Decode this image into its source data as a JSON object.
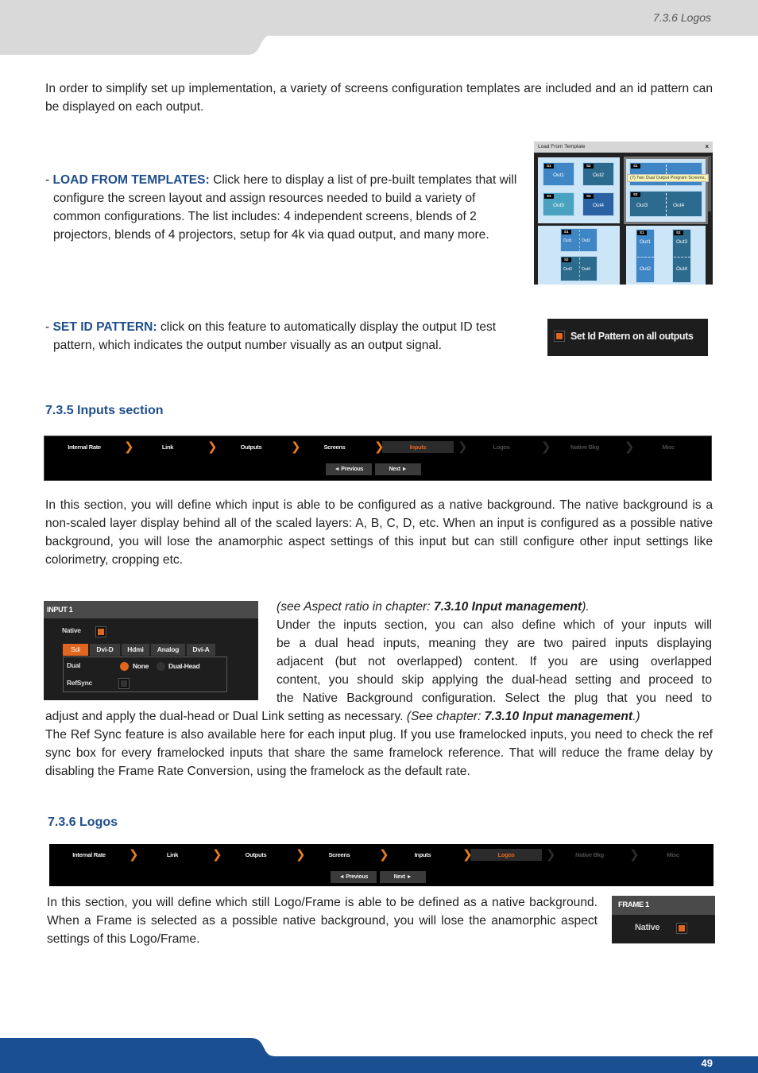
{
  "header": {
    "section_title": "7.3.6 Logos"
  },
  "intro": "In order to simplify set up implementation, a variety of screens configuration templates are included and an id pattern can be displayed on each output.",
  "load_templates": {
    "label": "LOAD FROM TEMPLATES:",
    "text": " Click here to display a list of pre-built templates that will configure the screen layout and assign resources needed to build a variety of common configurations. The list includes: 4 independent screens, blends of 2 projectors, blends of 4 projectors, setup for 4k via quad output, and many more."
  },
  "template_dialog": {
    "title": "Load From Template",
    "close": "×",
    "tooltip": "(7) Two Dual Output Program Screens,",
    "cards": [
      {
        "outputs": [
          {
            "tag": "S1",
            "label": "Out1"
          },
          {
            "tag": "S2",
            "label": "Out2"
          },
          {
            "tag": "S3",
            "label": "Out3"
          },
          {
            "tag": "S4",
            "label": "Out4"
          }
        ]
      },
      {
        "outputs": [
          {
            "tag": "S1",
            "label": "Out1"
          },
          {
            "tag": "",
            "label": "Out2"
          },
          {
            "tag": "S2",
            "label": "Out3"
          },
          {
            "tag": "",
            "label": "Out4"
          }
        ]
      },
      {
        "outputs": [
          {
            "tag": "S1",
            "label": "Out1",
            "rot": "90°"
          },
          {
            "tag": "",
            "label": "Out2",
            "rot": "90°"
          },
          {
            "tag": "S2",
            "label": "Out3",
            "rot": "90°"
          },
          {
            "tag": "",
            "label": "Out4",
            "rot": "90°"
          }
        ]
      },
      {
        "outputs": [
          {
            "tag": "S1",
            "label": "Out1",
            "rot": "90°"
          },
          {
            "tag": "",
            "label": "Out2",
            "rot": "90°"
          },
          {
            "tag": "S2",
            "label": "Out3",
            "rot": "90°"
          },
          {
            "tag": "",
            "label": "Out4",
            "rot": "90°"
          }
        ]
      }
    ]
  },
  "set_id_pattern": {
    "label": "SET ID PATTERN:",
    "text": " click on this feature to automatically display the output ID test pattern, which indicates the output number visually as an output signal.",
    "checkbox_label": "Set Id Pattern on all outputs",
    "checked": true
  },
  "inputs_section": {
    "heading": "7.3.5 Inputs section",
    "wizard": {
      "steps": [
        "Internal Rate",
        "Link",
        "Outputs",
        "Screens",
        "Inputs",
        "Logos",
        "Native Bkg",
        "Misc"
      ],
      "active": "Inputs",
      "previous": "◄ Previous",
      "next": "Next ►"
    },
    "para1": "In this section, you will define which input is able to be configured as a native background. The native background is a non-scaled layer display behind all of the scaled layers: A, B, C, D, etc. When an input is configured as a possible native background, you will lose the anamorphic aspect settings of this input but can still configure other input settings like colorimetry, cropping etc.",
    "see_prefix": "(see Aspect ratio in chapter: ",
    "see_ref": "7.3.10 Input management",
    "see_suffix": ").",
    "para2_lines": [
      "Under the inputs section, you can also define which of your inputs will",
      "be a dual head inputs, meaning they are two paired inputs displaying",
      "adjacent (but not overlapped) content. If you are using overlapped",
      "content, you should skip applying the dual-head setting and proceed to",
      "the Native Background configuration. Select the plug that you need to"
    ],
    "para2_tail": "adjust and apply the dual-head or Dual Link setting as necessary. ",
    "see2_prefix": "(See chapter: ",
    "see2_ref": "7.3.10 Input management",
    "see2_suffix": ".)",
    "para3": "The Ref Sync feature is also available here for each input plug. If you use framelocked inputs, you need to check the ref sync box for every framelocked inputs that share the same framelock reference. That will reduce the frame delay by disabling the Frame Rate Conversion, using the framelock as the default rate.",
    "input_panel": {
      "title": "INPUT 1",
      "native_label": "Native",
      "native_checked": true,
      "tabs": [
        "Sdi",
        "Dvi-D",
        "Hdmi",
        "Analog",
        "Dvi-A"
      ],
      "active_tab": "Sdi",
      "dual_label": "Dual",
      "dual_options": [
        "None",
        "Dual-Head"
      ],
      "dual_selected": "None",
      "refsync_label": "RefSync",
      "refsync_checked": false
    }
  },
  "logos_section": {
    "heading": "7.3.6 Logos",
    "wizard": {
      "steps": [
        "Internal Rate",
        "Link",
        "Outputs",
        "Screens",
        "Inputs",
        "Logos",
        "Native Bkg",
        "Misc"
      ],
      "active": "Logos",
      "previous": "◄ Previous",
      "next": "Next ►"
    },
    "para": "In this section, you will define which still Logo/Frame is able to be defined as a native background. When a Frame is selected as a possible native background, you will lose the anamorphic aspect settings of this Logo/Frame.",
    "frame_panel": {
      "title": "FRAME 1",
      "native_label": "Native",
      "native_checked": true
    }
  },
  "footer": {
    "page_number": "49"
  }
}
